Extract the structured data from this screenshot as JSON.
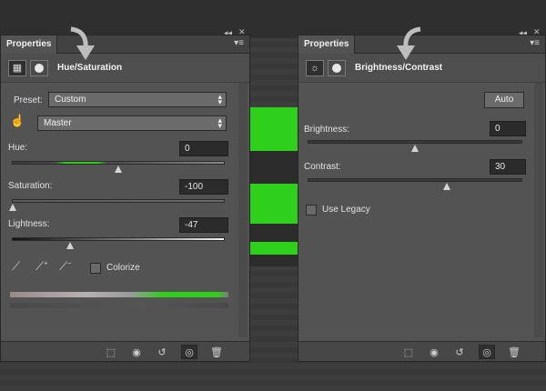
{
  "left_panel": {
    "tab": "Properties",
    "title": "Hue/Saturation",
    "preset_label": "Preset:",
    "preset_value": "Custom",
    "channel_value": "Master",
    "hue_label": "Hue:",
    "hue_value": "0",
    "saturation_label": "Saturation:",
    "saturation_value": "-100",
    "lightness_label": "Lightness:",
    "lightness_value": "-47",
    "colorize_label": "Colorize"
  },
  "right_panel": {
    "tab": "Properties",
    "title": "Brightness/Contrast",
    "auto_label": "Auto",
    "brightness_label": "Brightness:",
    "brightness_value": "0",
    "contrast_label": "Contrast:",
    "contrast_value": "30",
    "use_legacy_label": "Use Legacy"
  },
  "controls": {
    "hue_level": 0.5,
    "saturation_level": 0.0,
    "lightness_level": 0.27,
    "brightness_level": 0.5,
    "contrast_level": 0.65
  },
  "icons": [
    "collapse-icon",
    "close-icon",
    "panel-menu-icon",
    "adjustment-layer-icon",
    "layer-mask-icon",
    "sun-icon",
    "targeted-adjust-hand-icon",
    "eyedropper-icon",
    "eyedropper-plus-icon",
    "eyedropper-minus-icon",
    "clip-to-layer-icon",
    "view-previous-icon",
    "reset-icon",
    "visibility-eye-icon",
    "trash-icon"
  ],
  "colors": {
    "panel": "#535353",
    "accent_green": "#2fd01b"
  }
}
